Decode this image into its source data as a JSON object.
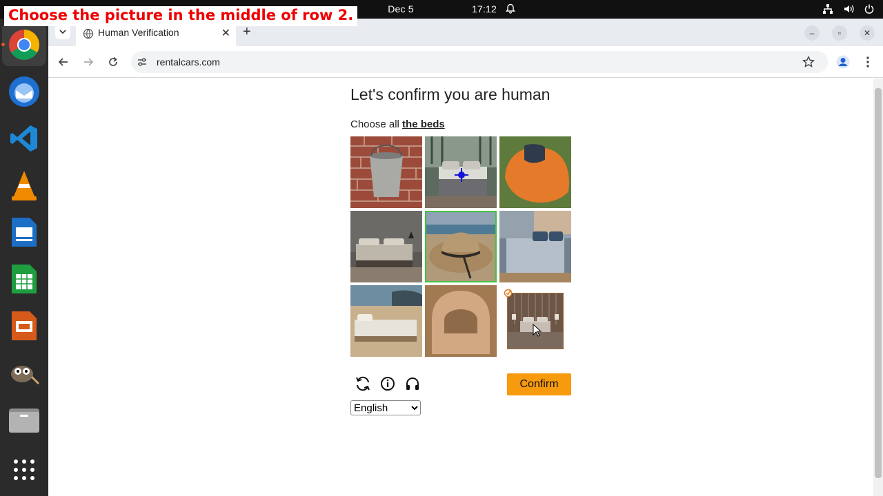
{
  "overlay": {
    "instruction": "Choose the picture in the middle of row 2."
  },
  "system": {
    "date": "Dec 5",
    "time": "17:12"
  },
  "dock": {
    "apps": [
      "chrome-icon",
      "thunderbird-icon",
      "vscode-icon",
      "vlc-icon",
      "writer-icon",
      "calc-icon",
      "impress-icon",
      "gimp-icon",
      "files-icon",
      "app-grid-icon"
    ]
  },
  "browser": {
    "tab_title": "Human Verification",
    "url": "rentalcars.com"
  },
  "captcha": {
    "title": "Let's confirm you are human",
    "prompt_prefix": "Choose all ",
    "prompt_target": "the beds",
    "confirm_label": "Confirm",
    "language": "English",
    "tiles": [
      {
        "row": 1,
        "col": 1,
        "content": "metal bucket on brick wall",
        "selected": false
      },
      {
        "row": 1,
        "col": 2,
        "content": "bed in forest room",
        "selected": false
      },
      {
        "row": 1,
        "col": 3,
        "content": "orange bag on grass",
        "selected": false
      },
      {
        "row": 2,
        "col": 1,
        "content": "low bed in dark room",
        "selected": false
      },
      {
        "row": 2,
        "col": 2,
        "content": "hat on beach",
        "selected": true
      },
      {
        "row": 2,
        "col": 3,
        "content": "bed with blue pillows",
        "selected": false
      },
      {
        "row": 3,
        "col": 1,
        "content": "bed on beach",
        "selected": false
      },
      {
        "row": 3,
        "col": 2,
        "content": "tan bag",
        "selected": false
      },
      {
        "row": 3,
        "col": 3,
        "content": "bedroom with wooden wall",
        "selected": true
      }
    ]
  },
  "colors": {
    "confirm_bg": "#f79a0e",
    "selected_border": "#3ec43e",
    "overlay_text": "#ee0000"
  }
}
